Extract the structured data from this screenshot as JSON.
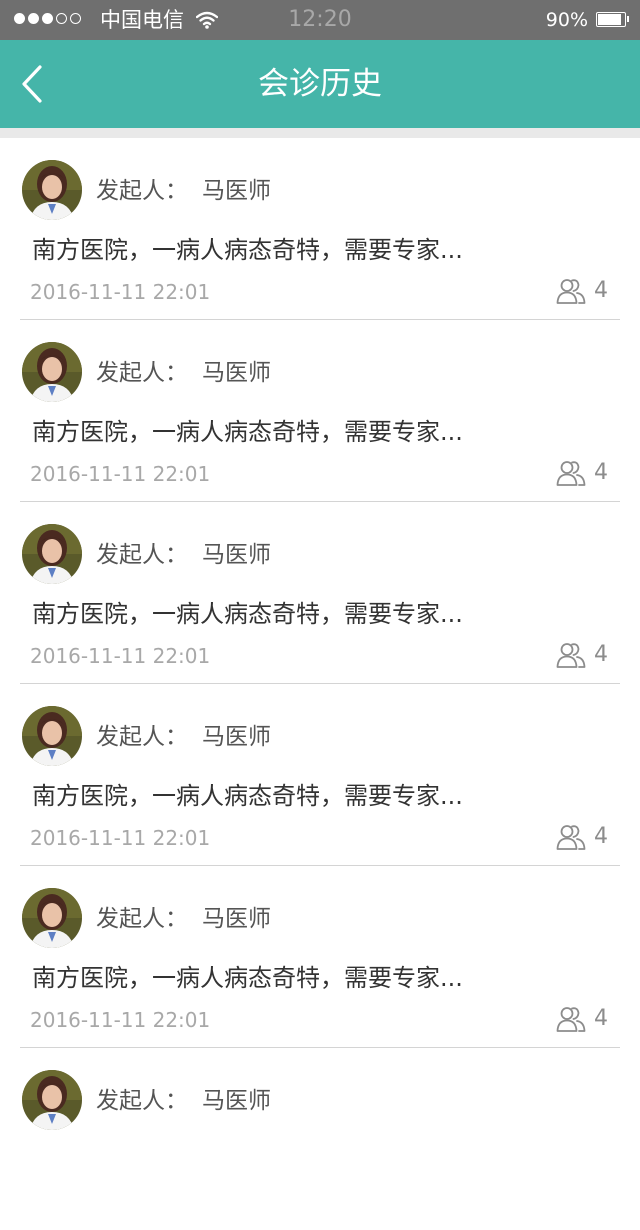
{
  "status_bar": {
    "carrier": "中国电信",
    "time": "12:20",
    "battery": "90%",
    "battery_level": 0.9,
    "signal_bars_filled": 3,
    "signal_bars_total": 5
  },
  "nav": {
    "title": "会诊历史",
    "back_icon": "chevron-left-icon"
  },
  "colors": {
    "accent": "#45b5a9",
    "status_bar": "#6f6f6f"
  },
  "consultations": [
    {
      "initiator_label": "发起人：",
      "initiator_name": "马医师",
      "description": "南方医院，一病人病态奇特，需要专家...",
      "time": "2016-11-11 22:01",
      "participants": "4"
    },
    {
      "initiator_label": "发起人：",
      "initiator_name": "马医师",
      "description": "南方医院，一病人病态奇特，需要专家...",
      "time": "2016-11-11 22:01",
      "participants": "4"
    },
    {
      "initiator_label": "发起人：",
      "initiator_name": "马医师",
      "description": "南方医院，一病人病态奇特，需要专家...",
      "time": "2016-11-11 22:01",
      "participants": "4"
    },
    {
      "initiator_label": "发起人：",
      "initiator_name": "马医师",
      "description": "南方医院，一病人病态奇特，需要专家...",
      "time": "2016-11-11 22:01",
      "participants": "4"
    },
    {
      "initiator_label": "发起人：",
      "initiator_name": "马医师",
      "description": "南方医院，一病人病态奇特，需要专家...",
      "time": "2016-11-11 22:01",
      "participants": "4"
    },
    {
      "initiator_label": "发起人：",
      "initiator_name": "马医师"
    }
  ]
}
